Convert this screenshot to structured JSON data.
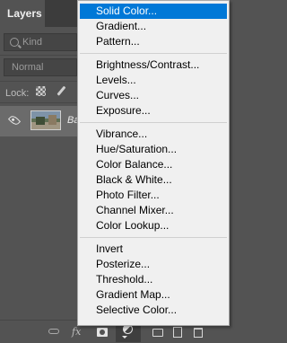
{
  "panel": {
    "tab_label": "Layers",
    "filter_kind": "Kind",
    "blend_mode": "Normal",
    "lock_label": "Lock:",
    "layer_name": "Ba"
  },
  "bottom_bar": {
    "fx_label": "fx"
  },
  "menu": {
    "selected_item": "Solid Color...",
    "groups": [
      [
        "Solid Color...",
        "Gradient...",
        "Pattern..."
      ],
      [
        "Brightness/Contrast...",
        "Levels...",
        "Curves...",
        "Exposure..."
      ],
      [
        "Vibrance...",
        "Hue/Saturation...",
        "Color Balance...",
        "Black & White...",
        "Photo Filter...",
        "Channel Mixer...",
        "Color Lookup..."
      ],
      [
        "Invert",
        "Posterize...",
        "Threshold...",
        "Gradient Map...",
        "Selective Color..."
      ]
    ]
  },
  "colors": {
    "panel_bg": "#535353",
    "menu_bg": "#f0f0f0",
    "selection": "#0078d7"
  }
}
